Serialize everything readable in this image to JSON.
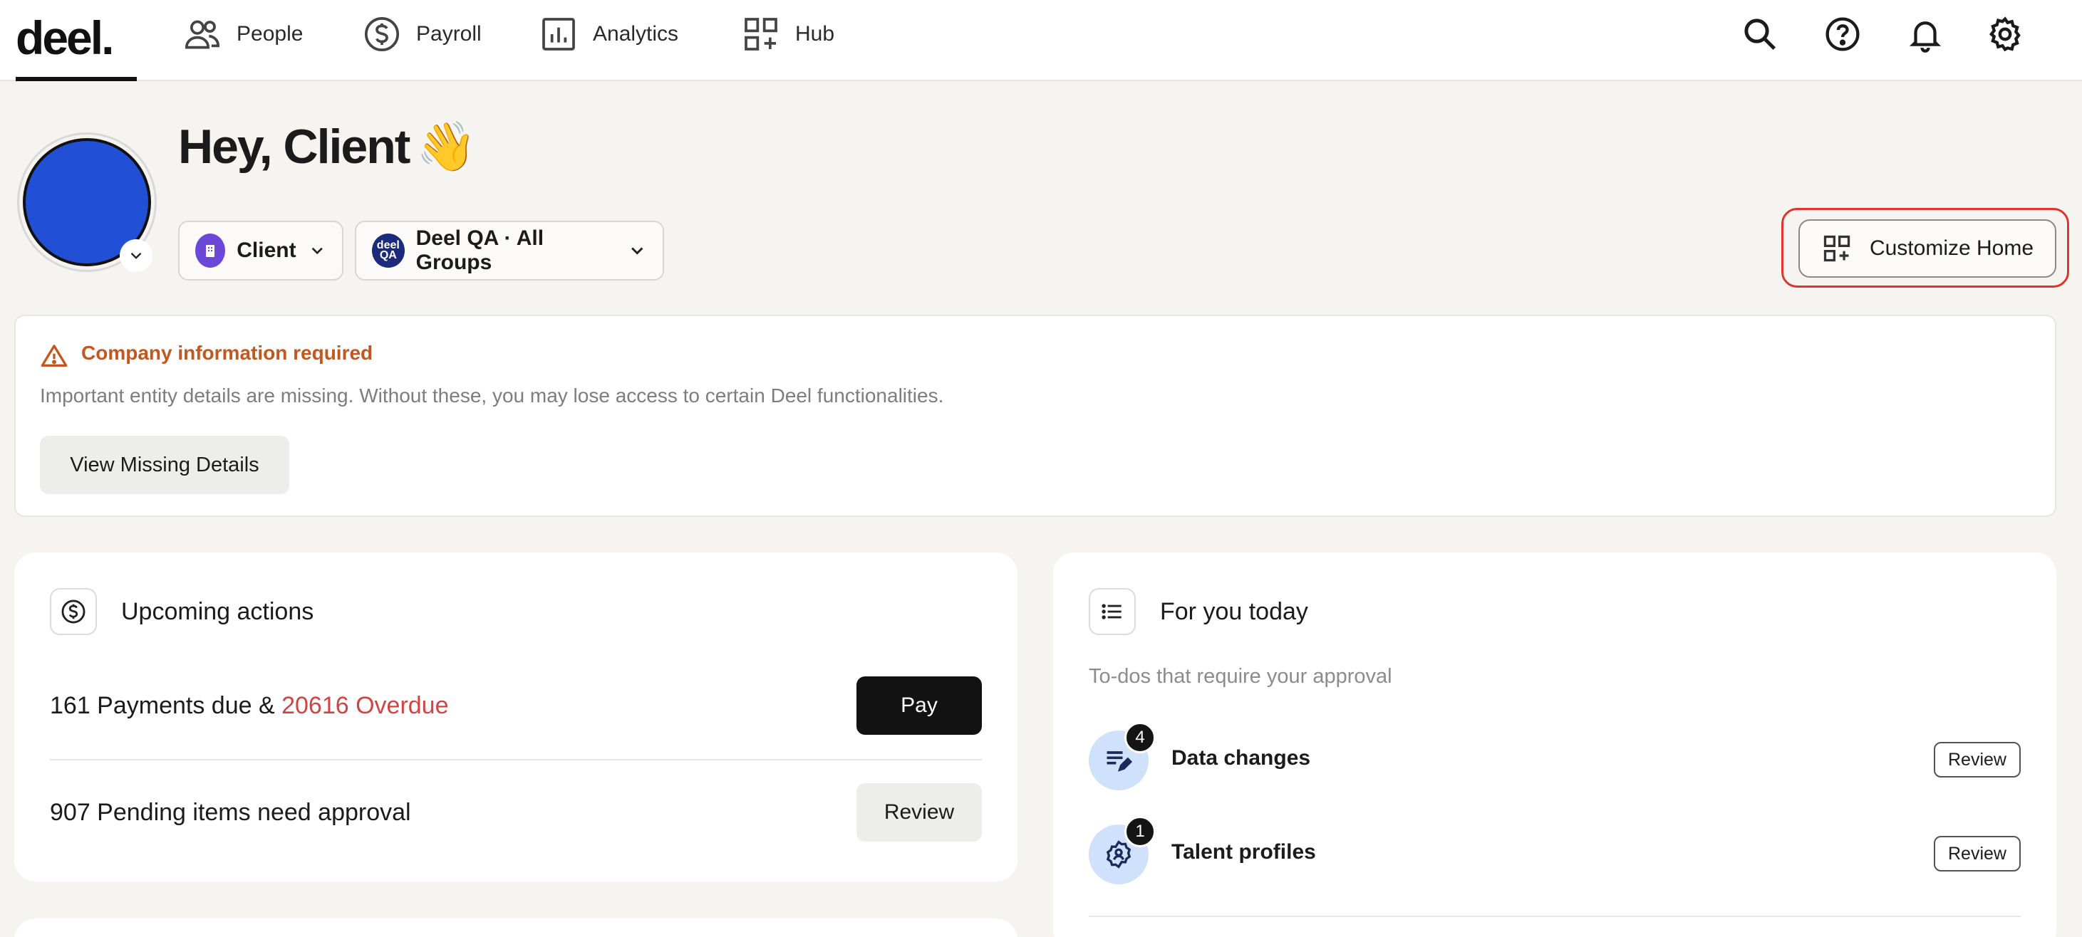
{
  "nav": {
    "logo": "deel.",
    "items": [
      {
        "label": "People",
        "icon": "people-icon"
      },
      {
        "label": "Payroll",
        "icon": "dollar-circle-icon"
      },
      {
        "label": "Analytics",
        "icon": "bar-chart-icon"
      },
      {
        "label": "Hub",
        "icon": "grid-plus-icon"
      }
    ],
    "right_icons": [
      "search-icon",
      "help-icon",
      "bell-icon",
      "gear-icon"
    ]
  },
  "greeting": {
    "text": "Hey, Client",
    "emoji": "👋",
    "role_selector": "Client",
    "org_selector": "Deel QA · All Groups",
    "org_badge": "deel QA"
  },
  "customize": {
    "label": "Customize Home"
  },
  "alert": {
    "title": "Company information required",
    "message": "Important entity details are missing. Without these, you may lose access to certain Deel functionalities.",
    "button": "View Missing Details",
    "color": "#c2571f"
  },
  "upcoming": {
    "title": "Upcoming actions",
    "payments_text": "161 Payments due & ",
    "overdue_text": "20616 Overdue",
    "pay_button": "Pay",
    "pending_text": "907 Pending items need approval",
    "review_button": "Review"
  },
  "today": {
    "title": "For you today",
    "subtitle": "To-dos that require your approval",
    "items": [
      {
        "label": "Data changes",
        "count": "4",
        "button": "Review"
      },
      {
        "label": "Talent profiles",
        "count": "1",
        "button": "Review"
      }
    ]
  },
  "colors": {
    "accent_red": "#e0352b",
    "overdue": "#d24444",
    "avatar": "#2150d6"
  }
}
